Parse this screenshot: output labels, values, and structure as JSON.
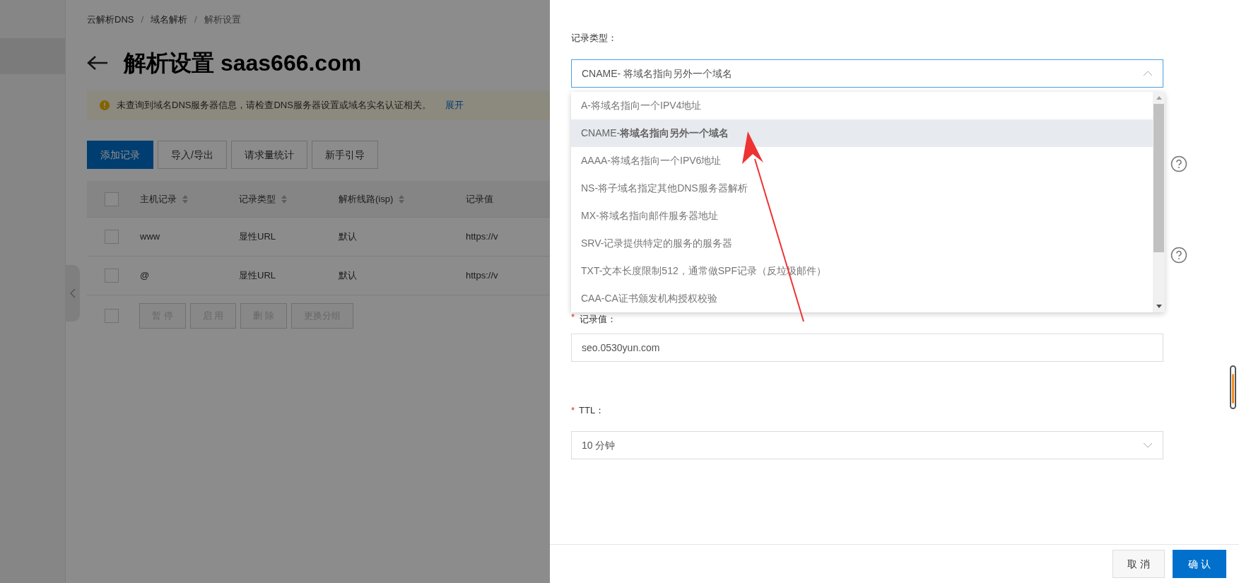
{
  "breadcrumb": [
    {
      "label": "云解析DNS",
      "separator": "/"
    },
    {
      "label": "域名解析",
      "separator": "/"
    },
    {
      "label": "解析设置"
    }
  ],
  "title": "解析设置 saas666.com",
  "alert": {
    "text": "未查询到域名DNS服务器信息，请检查DNS服务器设置或域名实名认证相关。",
    "link": "展开"
  },
  "toolbar": [
    {
      "label": "添加记录",
      "primary": true
    },
    {
      "label": "导入/导出",
      "primary": false
    },
    {
      "label": "请求量统计",
      "primary": false
    },
    {
      "label": "新手引导",
      "primary": false
    }
  ],
  "table": {
    "all_checked": false,
    "columns": [
      {
        "label": "主机记录",
        "sortable": true
      },
      {
        "label": "记录类型",
        "sortable": true
      },
      {
        "label": "解析线路(isp)",
        "sortable": true
      },
      {
        "label": "记录值",
        "sortable": false
      }
    ],
    "rows": [
      {
        "checked": false,
        "cells": [
          "www",
          "显性URL",
          "默认",
          "https://v"
        ]
      },
      {
        "checked": false,
        "cells": [
          "@",
          "显性URL",
          "默认",
          "https://v"
        ]
      }
    ],
    "batch_checked": false,
    "batch_actions": [
      "暂 停",
      "启 用",
      "删 除",
      "更换分组"
    ]
  },
  "panel": {
    "type_label": "记录类型：",
    "type_value": "CNAME- 将域名指向另外一个域名",
    "expanded": true,
    "options": [
      {
        "code": "A-",
        "desc": "将域名指向一个IPV4地址",
        "selected": false
      },
      {
        "code": "CNAME-",
        "desc": "将域名指向另外一个域名",
        "selected": true
      },
      {
        "code": "AAAA-",
        "desc": "将域名指向一个IPV6地址",
        "selected": false
      },
      {
        "code": "NS-",
        "desc": "将子域名指定其他DNS服务器解析",
        "selected": false
      },
      {
        "code": "MX-",
        "desc": "将域名指向邮件服务器地址",
        "selected": false
      },
      {
        "code": "SRV-",
        "desc": "记录提供特定的服务的服务器",
        "selected": false
      },
      {
        "code": "TXT-",
        "desc": "文本长度限制512，通常做SPF记录（反垃圾邮件）",
        "selected": false
      },
      {
        "code": "CAA-",
        "desc": "CA证书颁发机构授权校验",
        "selected": false
      }
    ],
    "value_required_mark": "*",
    "value_label": "记录值：",
    "value": "seo.0530yun.com",
    "ttl_required_mark": "*",
    "ttl_label": "TTL：",
    "ttl_value": "10 分钟",
    "buttons": [
      {
        "label": "取 消",
        "primary": false
      },
      {
        "label": "确 认",
        "primary": true
      }
    ]
  }
}
